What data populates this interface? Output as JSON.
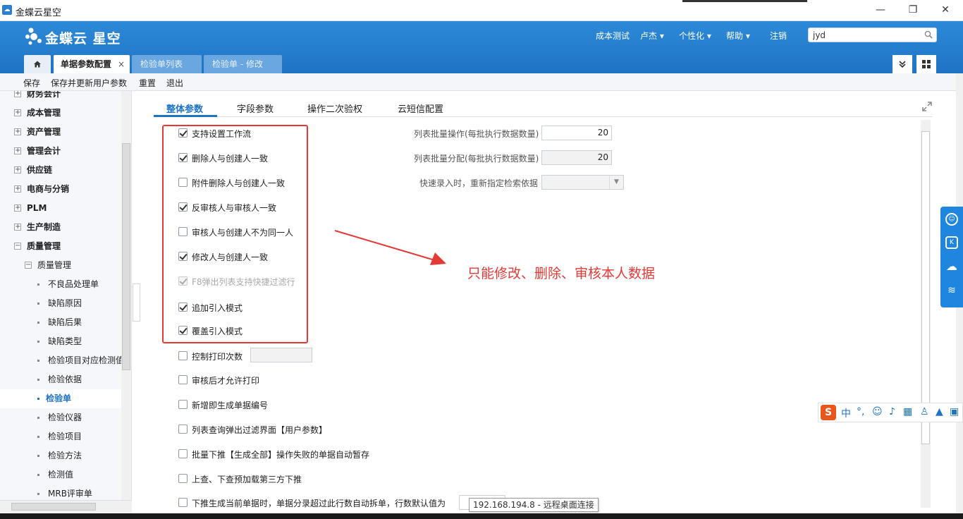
{
  "window": {
    "title": "金蝶云星空",
    "minimize": "—",
    "restore": "❐",
    "close": "✕"
  },
  "header": {
    "logo_text": "金蝶云 星空",
    "nav": [
      "成本测试",
      "卢杰 ▾",
      "个性化 ▾",
      "帮助 ▾",
      "注销"
    ],
    "search_value": "jyd"
  },
  "tabs": {
    "home": "⌂",
    "items": [
      "单据参数配置",
      "检验单列表",
      "检验单 - 修改"
    ],
    "close": "×"
  },
  "toolbar": [
    "保存",
    "保存并更新用户参数",
    "重置",
    "退出"
  ],
  "sidebar": {
    "items": [
      {
        "label": "财务会计",
        "level": 0
      },
      {
        "label": "成本管理",
        "level": 0
      },
      {
        "label": "资产管理",
        "level": 0
      },
      {
        "label": "管理会计",
        "level": 0
      },
      {
        "label": "供应链",
        "level": 0
      },
      {
        "label": "电商与分销",
        "level": 0
      },
      {
        "label": "PLM",
        "level": 0
      },
      {
        "label": "生产制造",
        "level": 0
      },
      {
        "label": "质量管理",
        "level": 0
      },
      {
        "label": "质量管理",
        "level": 1
      },
      {
        "label": "不良品处理单",
        "level": 2
      },
      {
        "label": "缺陷原因",
        "level": 2
      },
      {
        "label": "缺陷后果",
        "level": 2
      },
      {
        "label": "缺陷类型",
        "level": 2
      },
      {
        "label": "检验项目对应检测值",
        "level": 2
      },
      {
        "label": "检验依据",
        "level": 2
      },
      {
        "label": "检验单",
        "level": 2
      },
      {
        "label": "检验仪器",
        "level": 2
      },
      {
        "label": "检验项目",
        "level": 2
      },
      {
        "label": "检验方法",
        "level": 2
      },
      {
        "label": "检测值",
        "level": 2
      },
      {
        "label": "MRB评审单",
        "level": 2
      }
    ],
    "selected": "检验单"
  },
  "content": {
    "tabs": [
      "整体参数",
      "字段参数",
      "操作二次验权",
      "云短信配置"
    ],
    "options": [
      {
        "label": "支持设置工作流",
        "checked": true
      },
      {
        "label": "删除人与创建人一致",
        "checked": true
      },
      {
        "label": "附件删除人与创建人一致",
        "checked": false
      },
      {
        "label": "反审核人与审核人一致",
        "checked": true
      },
      {
        "label": "审核人与创建人不为同一人",
        "checked": false
      },
      {
        "label": "修改人与创建人一致",
        "checked": true
      },
      {
        "label": "F8弹出列表支持快捷过滤行",
        "checked": true,
        "disabled": true
      },
      {
        "label": "追加引入模式",
        "checked": true
      },
      {
        "label": "覆盖引入模式",
        "checked": true
      },
      {
        "label": "控制打印次数",
        "checked": false
      },
      {
        "label": "审核后才允许打印",
        "checked": false
      },
      {
        "label": "新增即生成单据编号",
        "checked": false
      },
      {
        "label": "列表查询弹出过滤界面【用户参数】",
        "checked": false
      },
      {
        "label": "批量下推【生成全部】操作失败的单据自动暂存",
        "checked": false
      },
      {
        "label": "上查、下查预加载第三方下推",
        "checked": false
      },
      {
        "label": "下推生成当前单据时，单据分录超过此行数自动拆单，行数默认值为",
        "checked": false
      }
    ],
    "right_fields": [
      {
        "label": "列表批量操作(每批执行数据数量)",
        "value": "20"
      },
      {
        "label": "列表批量分配(每批执行数据数量)",
        "value": "20"
      },
      {
        "label": "快速录入时，重新指定检索依据",
        "value": ""
      }
    ]
  },
  "annotation": "只能修改、删除、审核本人数据",
  "tooltip": "192.168.194.8 - 远程桌面连接",
  "ime": {
    "label": "中"
  },
  "colors": {
    "accent": "#1f73c4",
    "annotation": "#e53935",
    "header": "#2d8ad8"
  }
}
